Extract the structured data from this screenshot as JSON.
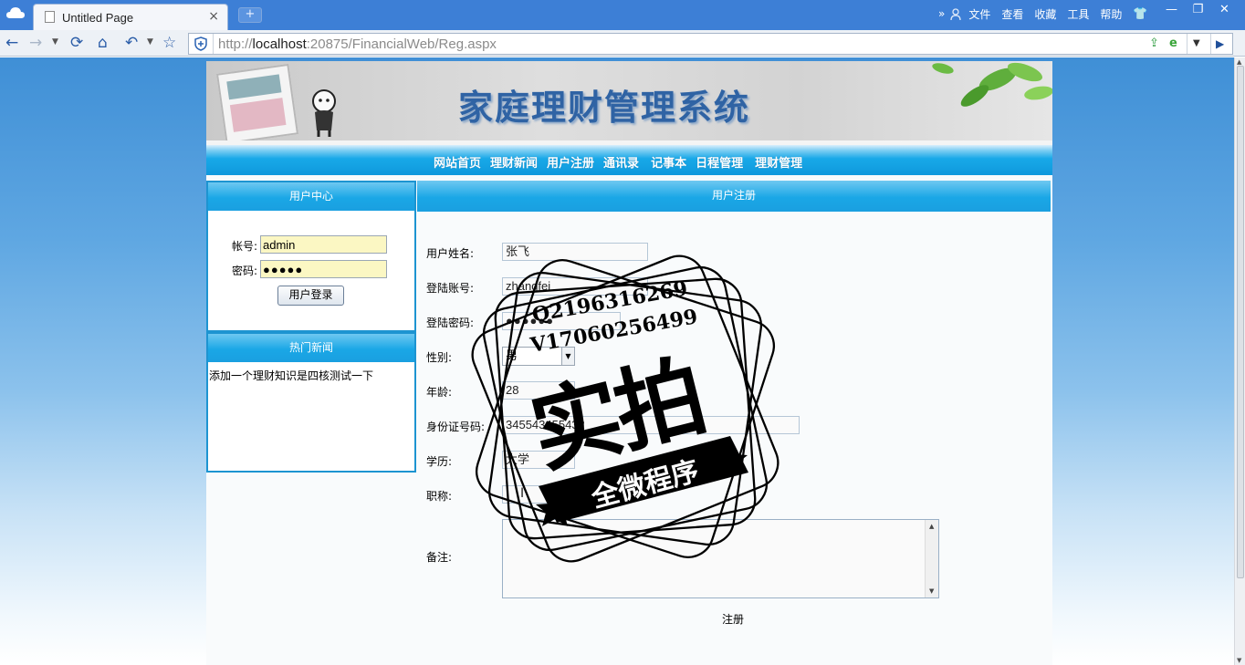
{
  "browser": {
    "tab_title": "Untitled Page",
    "tab_close": "×",
    "new_tab": "+",
    "menu_chevron": "»",
    "menu": [
      "文件",
      "查看",
      "收藏",
      "工具",
      "帮助"
    ],
    "window_controls": [
      "—",
      "❐",
      "✕"
    ],
    "url_host_prefix": "http://",
    "url_host": "localhost",
    "url_rest": ":20875/FinancialWeb/Reg.aspx",
    "accent_color": "#3d7fd6"
  },
  "site": {
    "title": "家庭理财管理系统",
    "nav": [
      "网站首页",
      "理财新闻",
      "用户注册",
      "通讯录",
      "记事本",
      "日程管理",
      "理财管理"
    ]
  },
  "login": {
    "header": "用户中心",
    "account_label": "帐号:",
    "account_value": "admin",
    "password_label": "密码:",
    "password_value": "●●●●●",
    "submit": "用户登录"
  },
  "news": {
    "header": "热门新闻",
    "items": [
      "添加一个理财知识是四核测试一下"
    ]
  },
  "register": {
    "header": "用户注册",
    "fields": [
      {
        "label": "用户姓名:",
        "value": "张飞"
      },
      {
        "label": "登陆账号:",
        "value": "zhangfei"
      },
      {
        "label": "登陆密码:",
        "value": "●●●●●●"
      },
      {
        "label": "性别:",
        "value": "男"
      },
      {
        "label": "年龄:",
        "value": "28"
      },
      {
        "label": "身份证号码:",
        "value": "345543455432"
      },
      {
        "label": "学历:",
        "value": "大学"
      },
      {
        "label": "职称:",
        "value": ""
      },
      {
        "label": "备注:",
        "value": ""
      }
    ],
    "submit": "注册"
  },
  "watermark": {
    "qq": "Q2196316269",
    "wx": "V17060256499",
    "big": "实拍",
    "ribbon": "全微程序"
  }
}
